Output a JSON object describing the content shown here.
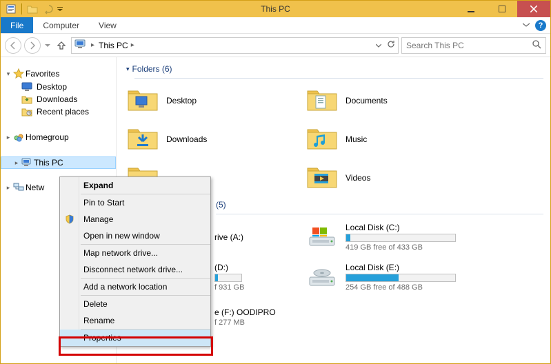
{
  "window": {
    "title": "This PC"
  },
  "ribbon": {
    "file": "File",
    "tabs": [
      "Computer",
      "View"
    ]
  },
  "nav": {
    "breadcrumb": "This PC",
    "search_placeholder": "Search This PC"
  },
  "tree": {
    "favorites": {
      "label": "Favorites",
      "items": [
        "Desktop",
        "Downloads",
        "Recent places"
      ]
    },
    "homegroup": "Homegroup",
    "thispc": "This PC",
    "network": "Netw"
  },
  "sections": {
    "folders_label": "Folders (6)",
    "devices_label_suffix": " (5)"
  },
  "folders": {
    "left": [
      "Desktop",
      "Downloads"
    ],
    "right": [
      "Documents",
      "Music",
      "Videos"
    ]
  },
  "drives": {
    "left": [
      {
        "name_suffix": "rive (A:)"
      },
      {
        "name_suffix": " (D:)",
        "sub_suffix": "f 931 GB"
      },
      {
        "name_suffix": "e (F:) OODIPRO",
        "sub_suffix": "f 277 MB"
      }
    ],
    "right": [
      {
        "name": "Local Disk (C:)",
        "sub": "419 GB free of 433 GB",
        "fill_pct": 4
      },
      {
        "name": "Local Disk (E:)",
        "sub": "254 GB free of 488 GB",
        "fill_pct": 48
      }
    ]
  },
  "context_menu": {
    "items": [
      "Expand",
      "Pin to Start",
      "Manage",
      "Open in new window",
      "Map network drive...",
      "Disconnect network drive...",
      "Add a network location",
      "Delete",
      "Rename",
      "Properties"
    ]
  }
}
